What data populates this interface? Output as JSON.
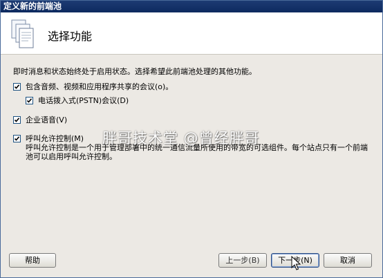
{
  "window": {
    "title": "定义新的前端池"
  },
  "header": {
    "title": "选择功能",
    "icon": "pages-icon"
  },
  "content": {
    "description": "即时消息和状态始终处于启用状态。选择希望此前端池处理的其他功能。",
    "options": [
      {
        "label": "包含音频、视频和应用程序共享的会议(o)。",
        "checked": true
      },
      {
        "label": "电话拨入式(PSTN)会议(D)",
        "checked": true
      },
      {
        "label": "企业语音(V)",
        "checked": true
      },
      {
        "label": "呼叫允许控制(M)",
        "checked": true
      }
    ],
    "cac_description": "呼叫允许控制是一个用于管理部署中的统一通信流量所使用的带宽的可选组件。每个站点只有一个前端池可以启用呼叫允许控制。"
  },
  "watermark": "胖哥技术堂 @曾经胖哥",
  "buttons": {
    "help": "帮助",
    "back": "上一步(B)",
    "next": "下一步(N)",
    "cancel": "取消"
  }
}
